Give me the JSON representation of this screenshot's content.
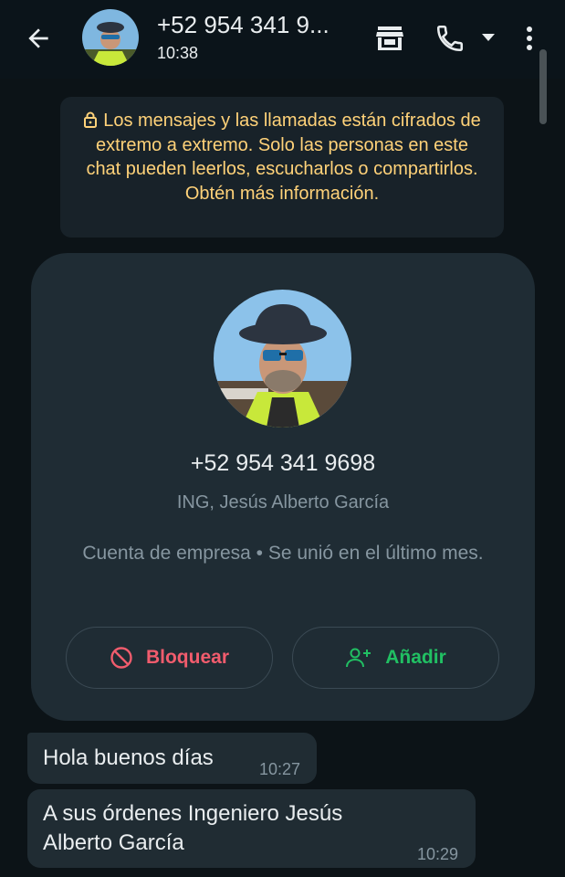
{
  "header": {
    "title": "+52 954 341 9...",
    "subtitle": "10:38",
    "back_icon": "arrow-left-icon",
    "shop_icon": "storefront-icon",
    "call_icon": "phone-icon",
    "caret_icon": "caret-down-icon",
    "more_icon": "more-vertical-icon"
  },
  "notice": {
    "text": "Los mensajes y las llamadas están cifrados de extremo a extremo. Solo las personas en este chat pueden leerlos, escucharlos o compartirlos. Obtén más información."
  },
  "card": {
    "phone": "+52 954 341 9698",
    "name": "ING, Jesús Alberto García",
    "description": "Cuenta de empresa • Se unió en el último mes.",
    "block_label": "Bloquear",
    "add_label": "Añadir"
  },
  "messages": [
    {
      "text": "Hola buenos días",
      "time": "10:27"
    },
    {
      "text": "A sus órdenes Ingeniero Jesús Alberto García",
      "time": "10:29"
    }
  ],
  "colors": {
    "background": "#0c1317",
    "bubble": "#202c33",
    "notice_text": "#ffd279",
    "block_red": "#f15c6d",
    "add_green": "#21c063"
  }
}
